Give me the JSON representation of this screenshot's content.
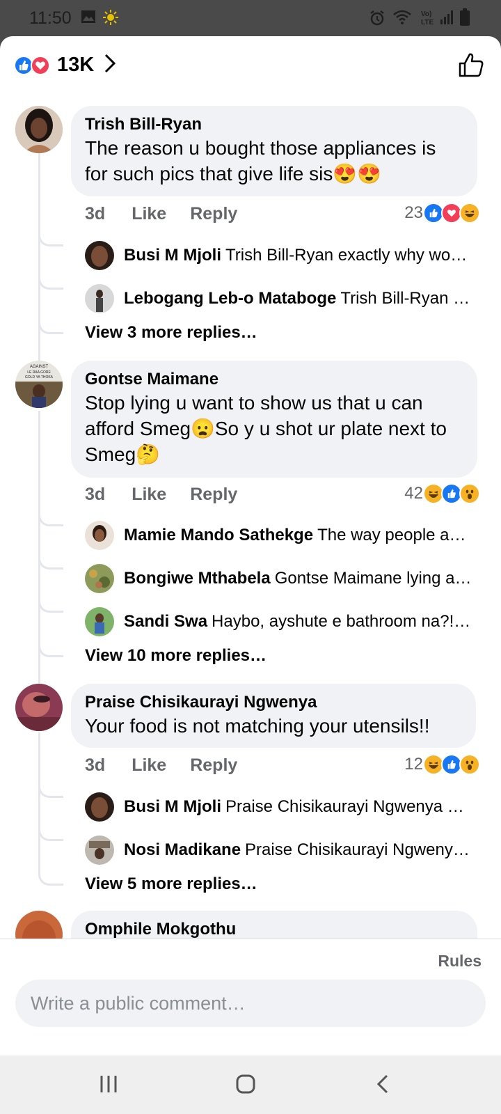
{
  "status_bar": {
    "time": "11:50",
    "icons": [
      "gallery-icon",
      "brightness-icon",
      "alarm-icon",
      "wifi-icon",
      "volte-icon",
      "signal-icon",
      "battery-icon"
    ]
  },
  "header": {
    "reaction_total": "13K",
    "reaction_icons": [
      "like-icon",
      "love-icon"
    ]
  },
  "comments": [
    {
      "author": "Trish Bill-Ryan",
      "text": "The reason u bought those appliances is for such pics that give life sis😍😍",
      "time": "3d",
      "like_label": "Like",
      "reply_label": "Reply",
      "reaction_count": "23",
      "reactions": [
        "like-icon",
        "love-icon",
        "haha-icon"
      ],
      "replies": [
        {
          "author": "Busi M Mjoli",
          "text": "Trish Bill-Ryan exactly why wo…"
        },
        {
          "author": "Lebogang Leb-o Mataboge",
          "text": "Trish Bill-Ryan …"
        }
      ],
      "more_replies": "View 3 more replies…"
    },
    {
      "author": "Gontse Maimane",
      "avatar_caption": "AGAINST ... LE RAA GORE ... GOLD YA THOKAHAL",
      "text": "Stop lying u want to show us that u can afford Smeg😦So y u shot ur plate next to Smeg🤔",
      "time": "3d",
      "like_label": "Like",
      "reply_label": "Reply",
      "reaction_count": "42",
      "reactions": [
        "haha-icon",
        "like-icon",
        "wow-icon"
      ],
      "replies": [
        {
          "author": "Mamie Mando Sathekge",
          "text": "The way people a…"
        },
        {
          "author": "Bongiwe Mthabela",
          "text": "Gontse Maimane lying a…"
        },
        {
          "author": "Sandi Swa",
          "text": "Haybo, ayshute e bathroom na?!…"
        }
      ],
      "more_replies": "View 10 more replies…"
    },
    {
      "author": "Praise Chisikaurayi Ngwenya",
      "text": "Your food is not matching your utensils!!",
      "time": "3d",
      "like_label": "Like",
      "reply_label": "Reply",
      "reaction_count": "12",
      "reactions": [
        "haha-icon",
        "like-icon",
        "wow-icon"
      ],
      "replies": [
        {
          "author": "Busi M Mjoli",
          "text": "Praise Chisikaurayi Ngwenya …"
        },
        {
          "author": "Nosi Madikane",
          "text": "Praise Chisikaurayi Ngweny…"
        }
      ],
      "more_replies": "View 5 more replies…"
    },
    {
      "author": "Omphile Mokgothu"
    }
  ],
  "footer": {
    "rules_label": "Rules",
    "composer_placeholder": "Write a public comment…"
  },
  "colors": {
    "like": "#1877f2",
    "love": "#f33e58",
    "haha": "#f7b125",
    "bubble": "#f0f2f5",
    "secondary_text": "#65676b"
  }
}
